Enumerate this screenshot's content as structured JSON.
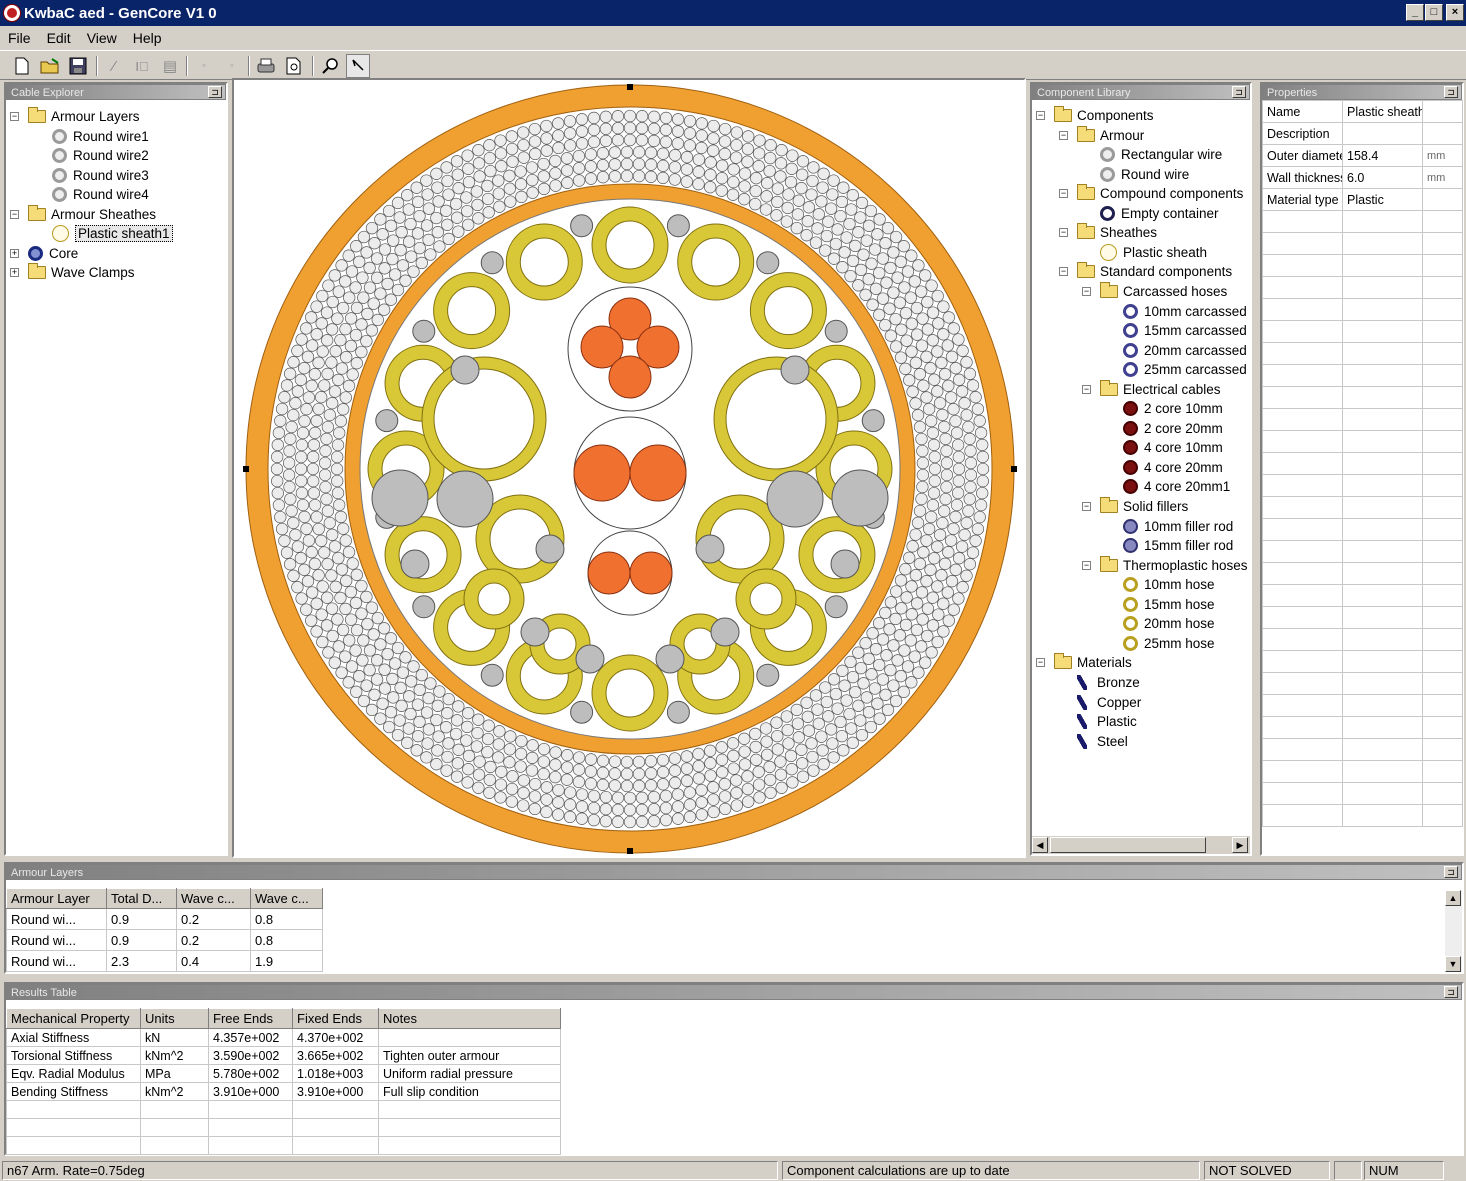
{
  "window": {
    "title": "KwbaC aed - GenCore V1 0",
    "controls": [
      "_",
      "□",
      "×"
    ]
  },
  "menu": [
    "File",
    "Edit",
    "View",
    "Help"
  ],
  "toolbar": {
    "icons": [
      "new-file-icon",
      "open-folder-icon",
      "save-icon",
      "line-tool-icon",
      "text-tool-icon",
      "table-tool-icon",
      "prev-icon",
      "next-icon",
      "print-icon",
      "print-preview-icon",
      "zoom-icon",
      "pointer-icon"
    ]
  },
  "left_panel": {
    "title": "Cable Explorer",
    "items": [
      {
        "label": "Armour Layers",
        "type": "folder",
        "level": 0,
        "expander": "-"
      },
      {
        "label": "Round wire1",
        "type": "wire",
        "level": 1
      },
      {
        "label": "Round wire2",
        "type": "wire",
        "level": 1
      },
      {
        "label": "Round wire3",
        "type": "wire",
        "level": 1
      },
      {
        "label": "Round wire4",
        "type": "wire",
        "level": 1
      },
      {
        "label": "Armour Sheathes",
        "type": "folder",
        "level": 0,
        "expander": "-"
      },
      {
        "label": "Plastic sheath1",
        "type": "sheath",
        "level": 1,
        "selected": true
      },
      {
        "label": "Core",
        "type": "core",
        "level": 0,
        "expander": "+"
      },
      {
        "label": "Wave Clamps",
        "type": "folder",
        "level": 0,
        "expander": "+"
      }
    ]
  },
  "components_panel": {
    "title": "Component Library",
    "items": [
      {
        "label": "Components",
        "type": "folder",
        "level": 0,
        "expander": "-"
      },
      {
        "label": "Armour",
        "type": "folder",
        "level": 1,
        "expander": "-"
      },
      {
        "label": "Rectangular wire",
        "type": "wire",
        "level": 2
      },
      {
        "label": "Round wire",
        "type": "wire",
        "level": 2
      },
      {
        "label": "Compound components",
        "type": "folder",
        "level": 1,
        "expander": "-"
      },
      {
        "label": "Empty container",
        "type": "container",
        "level": 2
      },
      {
        "label": "Sheathes",
        "type": "folder",
        "level": 1,
        "expander": "-"
      },
      {
        "label": "Plastic sheath",
        "type": "sheath",
        "level": 2
      },
      {
        "label": "Standard components",
        "type": "folder",
        "level": 1,
        "expander": "-"
      },
      {
        "label": "Carcassed hoses",
        "type": "folder",
        "level": 2,
        "expander": "-"
      },
      {
        "label": "10mm carcassed",
        "type": "hose-blue",
        "level": 3
      },
      {
        "label": "15mm carcassed",
        "type": "hose-blue",
        "level": 3
      },
      {
        "label": "20mm carcassed",
        "type": "hose-blue",
        "level": 3
      },
      {
        "label": "25mm carcassed",
        "type": "hose-blue",
        "level": 3
      },
      {
        "label": "Electrical cables",
        "type": "folder",
        "level": 2,
        "expander": "-"
      },
      {
        "label": "2 core 10mm",
        "type": "cable",
        "level": 3
      },
      {
        "label": "2 core 20mm",
        "type": "cable",
        "level": 3
      },
      {
        "label": "4 core 10mm",
        "type": "cable",
        "level": 3
      },
      {
        "label": "4 core 20mm",
        "type": "cable",
        "level": 3
      },
      {
        "label": "4 core 20mm1",
        "type": "cable",
        "level": 3
      },
      {
        "label": "Solid fillers",
        "type": "folder",
        "level": 2,
        "expander": "-"
      },
      {
        "label": "10mm filler rod",
        "type": "filler",
        "level": 3
      },
      {
        "label": "15mm filler rod",
        "type": "filler",
        "level": 3
      },
      {
        "label": "Thermoplastic hoses",
        "type": "folder",
        "level": 2,
        "expander": "-"
      },
      {
        "label": "10mm hose",
        "type": "thermo",
        "level": 3
      },
      {
        "label": "15mm hose",
        "type": "thermo",
        "level": 3
      },
      {
        "label": "20mm hose",
        "type": "thermo",
        "level": 3
      },
      {
        "label": "25mm hose",
        "type": "thermo",
        "level": 3
      },
      {
        "label": "Materials",
        "type": "folder",
        "level": 0,
        "expander": "-"
      },
      {
        "label": "Bronze",
        "type": "material",
        "level": 1
      },
      {
        "label": "Copper",
        "type": "material",
        "level": 1
      },
      {
        "label": "Plastic",
        "type": "material",
        "level": 1
      },
      {
        "label": "Steel",
        "type": "material",
        "level": 1
      }
    ]
  },
  "properties_panel": {
    "title": "Properties",
    "rows": [
      {
        "name": "Name",
        "value": "Plastic sheath",
        "unit": ""
      },
      {
        "name": "Description",
        "value": "",
        "unit": ""
      },
      {
        "name": "Outer diameter",
        "value": "158.4",
        "unit": "mm"
      },
      {
        "name": "Wall thickness",
        "value": "6.0",
        "unit": "mm"
      },
      {
        "name": "Material type",
        "value": "Plastic",
        "unit": ""
      }
    ]
  },
  "armour_panel": {
    "title": "Armour Layers",
    "columns": [
      "Armour Layer",
      "Total D...",
      "Wave c...",
      "Wave c..."
    ],
    "rows": [
      [
        "Round wi...",
        "0.9",
        "0.2",
        "0.8"
      ],
      [
        "Round wi...",
        "0.9",
        "0.2",
        "0.8"
      ],
      [
        "Round wi...",
        "2.3",
        "0.4",
        "1.9"
      ]
    ]
  },
  "results_panel": {
    "title": "Results Table",
    "columns": [
      "Mechanical Property",
      "Units",
      "Free Ends",
      "Fixed Ends",
      "Notes"
    ],
    "rows": [
      [
        "Axial Stiffness",
        "kN",
        "4.357e+002",
        "4.370e+002",
        ""
      ],
      [
        "Torsional Stiffness",
        "kNm^2",
        "3.590e+002",
        "3.665e+002",
        "Tighten outer armour"
      ],
      [
        "Eqv. Radial Modulus",
        "MPa",
        "5.780e+002",
        "1.018e+003",
        "Uniform radial pressure"
      ],
      [
        "Bending Stiffness",
        "kNm^2",
        "3.910e+000",
        "3.910e+000",
        "Full slip condition"
      ]
    ]
  },
  "status_bar": {
    "left": "n67 Arm. Rate=0.75deg",
    "middle": "Component calculations are up to date",
    "right": "NOT SOLVED",
    "mode": "NUM"
  },
  "colors": {
    "titlebar": "#0a246a",
    "outer_sheath": "#f0a030",
    "hose": "#d8c838",
    "cable_core": "#f07030",
    "filler": "#bdbdbd",
    "armour_wire": "#ececec"
  }
}
